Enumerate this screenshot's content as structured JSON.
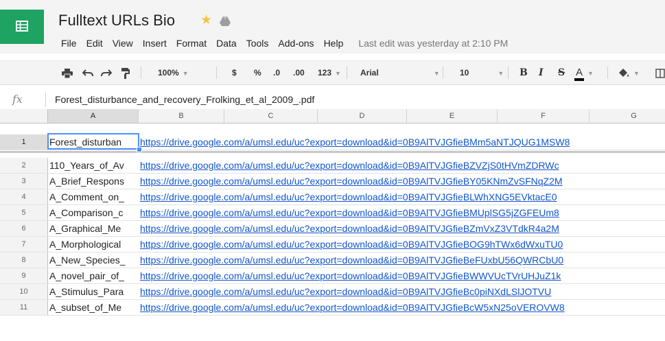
{
  "app": {
    "title": "Fulltext URLs Bio",
    "last_edit": "Last edit was yesterday at 2:10 PM"
  },
  "menu": [
    "File",
    "Edit",
    "View",
    "Insert",
    "Format",
    "Data",
    "Tools",
    "Add-ons",
    "Help"
  ],
  "toolbar": {
    "zoom": "100%",
    "currency": "$",
    "percent": "%",
    "decrease_decimal": ".0",
    "increase_decimal": ".00",
    "more_formats": "123",
    "font": "Arial",
    "font_size": "10",
    "bold": "B",
    "italic": "I",
    "strike": "S",
    "text_color": "A"
  },
  "formula_bar": {
    "label": "fx",
    "value": "Forest_disturbance_and_recovery_Frolking_et_al_2009_.pdf"
  },
  "columns": [
    "A",
    "B",
    "C",
    "D",
    "E",
    "F",
    "G"
  ],
  "active_cell": "A1",
  "rows": [
    {
      "num": "1",
      "a": "Forest_disturban",
      "b": "https://drive.google.com/a/umsl.edu/uc?export=download&id=0B9AlTVJGfieBMm5aNTJQUG1MSW8"
    },
    {
      "num": "2",
      "a": "110_Years_of_Av",
      "b": "https://drive.google.com/a/umsl.edu/uc?export=download&id=0B9AlTVJGfieBZVZjS0tHVmZDRWc"
    },
    {
      "num": "3",
      "a": "A_Brief_Respons",
      "b": "https://drive.google.com/a/umsl.edu/uc?export=download&id=0B9AlTVJGfieBY05KNmZvSFNqZ2M"
    },
    {
      "num": "4",
      "a": "A_Comment_on_",
      "b": "https://drive.google.com/a/umsl.edu/uc?export=download&id=0B9AlTVJGfieBLWhXNG5EVktacE0"
    },
    {
      "num": "5",
      "a": "A_Comparison_c",
      "b": "https://drive.google.com/a/umsl.edu/uc?export=download&id=0B9AlTVJGfieBMUplSG5jZGFEUm8"
    },
    {
      "num": "6",
      "a": "A_Graphical_Me",
      "b": "https://drive.google.com/a/umsl.edu/uc?export=download&id=0B9AlTVJGfieBZmVxZ3VTdkR4a2M"
    },
    {
      "num": "7",
      "a": "A_Morphological",
      "b": "https://drive.google.com/a/umsl.edu/uc?export=download&id=0B9AlTVJGfieBOG9hTWx6dWxuTU0"
    },
    {
      "num": "8",
      "a": "A_New_Species_",
      "b": "https://drive.google.com/a/umsl.edu/uc?export=download&id=0B9AlTVJGfieBeFUxbU56QWRCbU0"
    },
    {
      "num": "9",
      "a": "A_novel_pair_of_",
      "b": "https://drive.google.com/a/umsl.edu/uc?export=download&id=0B9AlTVJGfieBWWVUcTVrUHJuZ1k"
    },
    {
      "num": "10",
      "a": "A_Stimulus_Para",
      "b": "https://drive.google.com/a/umsl.edu/uc?export=download&id=0B9AlTVJGfieBc0piNXdLSlJOTVU"
    },
    {
      "num": "11",
      "a": "A_subset_of_Me",
      "b": "https://drive.google.com/a/umsl.edu/uc?export=download&id=0B9AlTVJGfieBcW5xN25oVEROVW8"
    }
  ],
  "colors": {
    "brand": "#1ea362",
    "link": "#1155cc",
    "selection": "#4d90fe",
    "star": "#f6c343"
  },
  "icons": [
    "sheets-logo-icon",
    "star-icon",
    "drive-folder-icon",
    "print-icon",
    "undo-icon",
    "redo-icon",
    "paint-format-icon",
    "fill-color-icon",
    "borders-icon"
  ]
}
